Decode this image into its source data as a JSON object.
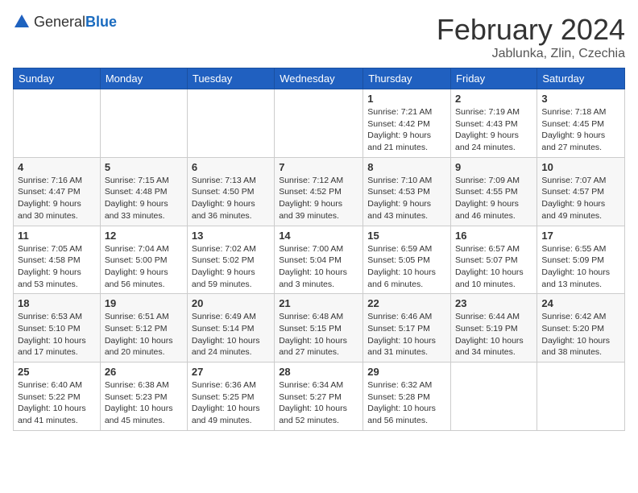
{
  "header": {
    "logo": {
      "general": "General",
      "blue": "Blue"
    },
    "month": "February 2024",
    "location": "Jablunka, Zlin, Czechia"
  },
  "days_of_week": [
    "Sunday",
    "Monday",
    "Tuesday",
    "Wednesday",
    "Thursday",
    "Friday",
    "Saturday"
  ],
  "weeks": [
    [
      {
        "num": "",
        "info": ""
      },
      {
        "num": "",
        "info": ""
      },
      {
        "num": "",
        "info": ""
      },
      {
        "num": "",
        "info": ""
      },
      {
        "num": "1",
        "info": "Sunrise: 7:21 AM\nSunset: 4:42 PM\nDaylight: 9 hours\nand 21 minutes."
      },
      {
        "num": "2",
        "info": "Sunrise: 7:19 AM\nSunset: 4:43 PM\nDaylight: 9 hours\nand 24 minutes."
      },
      {
        "num": "3",
        "info": "Sunrise: 7:18 AM\nSunset: 4:45 PM\nDaylight: 9 hours\nand 27 minutes."
      }
    ],
    [
      {
        "num": "4",
        "info": "Sunrise: 7:16 AM\nSunset: 4:47 PM\nDaylight: 9 hours\nand 30 minutes."
      },
      {
        "num": "5",
        "info": "Sunrise: 7:15 AM\nSunset: 4:48 PM\nDaylight: 9 hours\nand 33 minutes."
      },
      {
        "num": "6",
        "info": "Sunrise: 7:13 AM\nSunset: 4:50 PM\nDaylight: 9 hours\nand 36 minutes."
      },
      {
        "num": "7",
        "info": "Sunrise: 7:12 AM\nSunset: 4:52 PM\nDaylight: 9 hours\nand 39 minutes."
      },
      {
        "num": "8",
        "info": "Sunrise: 7:10 AM\nSunset: 4:53 PM\nDaylight: 9 hours\nand 43 minutes."
      },
      {
        "num": "9",
        "info": "Sunrise: 7:09 AM\nSunset: 4:55 PM\nDaylight: 9 hours\nand 46 minutes."
      },
      {
        "num": "10",
        "info": "Sunrise: 7:07 AM\nSunset: 4:57 PM\nDaylight: 9 hours\nand 49 minutes."
      }
    ],
    [
      {
        "num": "11",
        "info": "Sunrise: 7:05 AM\nSunset: 4:58 PM\nDaylight: 9 hours\nand 53 minutes."
      },
      {
        "num": "12",
        "info": "Sunrise: 7:04 AM\nSunset: 5:00 PM\nDaylight: 9 hours\nand 56 minutes."
      },
      {
        "num": "13",
        "info": "Sunrise: 7:02 AM\nSunset: 5:02 PM\nDaylight: 9 hours\nand 59 minutes."
      },
      {
        "num": "14",
        "info": "Sunrise: 7:00 AM\nSunset: 5:04 PM\nDaylight: 10 hours\nand 3 minutes."
      },
      {
        "num": "15",
        "info": "Sunrise: 6:59 AM\nSunset: 5:05 PM\nDaylight: 10 hours\nand 6 minutes."
      },
      {
        "num": "16",
        "info": "Sunrise: 6:57 AM\nSunset: 5:07 PM\nDaylight: 10 hours\nand 10 minutes."
      },
      {
        "num": "17",
        "info": "Sunrise: 6:55 AM\nSunset: 5:09 PM\nDaylight: 10 hours\nand 13 minutes."
      }
    ],
    [
      {
        "num": "18",
        "info": "Sunrise: 6:53 AM\nSunset: 5:10 PM\nDaylight: 10 hours\nand 17 minutes."
      },
      {
        "num": "19",
        "info": "Sunrise: 6:51 AM\nSunset: 5:12 PM\nDaylight: 10 hours\nand 20 minutes."
      },
      {
        "num": "20",
        "info": "Sunrise: 6:49 AM\nSunset: 5:14 PM\nDaylight: 10 hours\nand 24 minutes."
      },
      {
        "num": "21",
        "info": "Sunrise: 6:48 AM\nSunset: 5:15 PM\nDaylight: 10 hours\nand 27 minutes."
      },
      {
        "num": "22",
        "info": "Sunrise: 6:46 AM\nSunset: 5:17 PM\nDaylight: 10 hours\nand 31 minutes."
      },
      {
        "num": "23",
        "info": "Sunrise: 6:44 AM\nSunset: 5:19 PM\nDaylight: 10 hours\nand 34 minutes."
      },
      {
        "num": "24",
        "info": "Sunrise: 6:42 AM\nSunset: 5:20 PM\nDaylight: 10 hours\nand 38 minutes."
      }
    ],
    [
      {
        "num": "25",
        "info": "Sunrise: 6:40 AM\nSunset: 5:22 PM\nDaylight: 10 hours\nand 41 minutes."
      },
      {
        "num": "26",
        "info": "Sunrise: 6:38 AM\nSunset: 5:23 PM\nDaylight: 10 hours\nand 45 minutes."
      },
      {
        "num": "27",
        "info": "Sunrise: 6:36 AM\nSunset: 5:25 PM\nDaylight: 10 hours\nand 49 minutes."
      },
      {
        "num": "28",
        "info": "Sunrise: 6:34 AM\nSunset: 5:27 PM\nDaylight: 10 hours\nand 52 minutes."
      },
      {
        "num": "29",
        "info": "Sunrise: 6:32 AM\nSunset: 5:28 PM\nDaylight: 10 hours\nand 56 minutes."
      },
      {
        "num": "",
        "info": ""
      },
      {
        "num": "",
        "info": ""
      }
    ]
  ]
}
